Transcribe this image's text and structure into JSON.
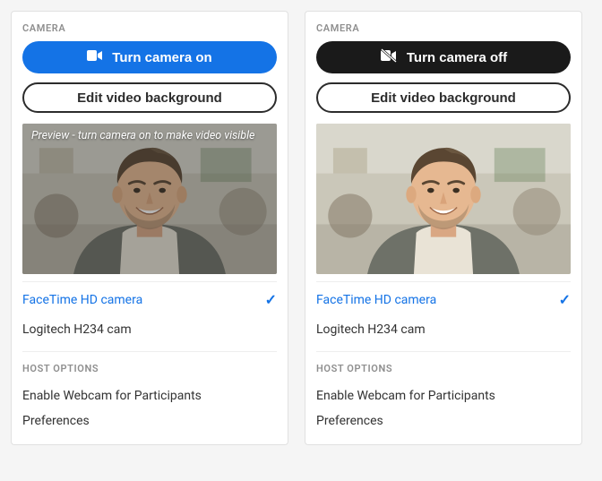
{
  "left": {
    "section_camera": "CAMERA",
    "primary_button": "Turn camera on",
    "secondary_button": "Edit video background",
    "preview_text": "Preview -  turn camera on to make video visible",
    "devices": [
      {
        "label": "FaceTime HD camera",
        "selected": true
      },
      {
        "label": "Logitech H234 cam",
        "selected": false
      }
    ],
    "section_host": "HOST OPTIONS",
    "host_items": [
      "Enable Webcam for Participants",
      "Preferences"
    ]
  },
  "right": {
    "section_camera": "CAMERA",
    "primary_button": "Turn camera off",
    "secondary_button": "Edit video background",
    "devices": [
      {
        "label": "FaceTime HD camera",
        "selected": true
      },
      {
        "label": "Logitech H234 cam",
        "selected": false
      }
    ],
    "section_host": "HOST OPTIONS",
    "host_items": [
      "Enable Webcam for Participants",
      "Preferences"
    ]
  }
}
